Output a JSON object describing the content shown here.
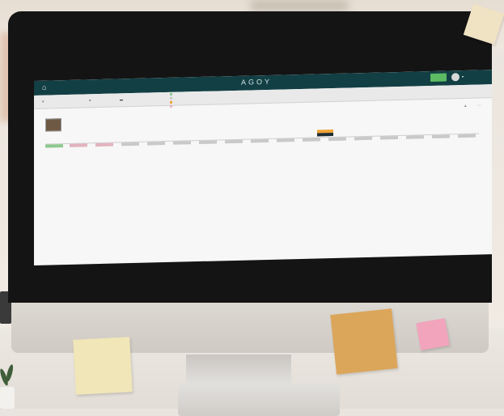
{
  "scene": {
    "background": "#ece6de",
    "note_colors": [
      "#f0e3c4",
      "#f1e6b8",
      "#dca65a",
      "#f2a4bd"
    ]
  },
  "app": {
    "home_icon": "home-icon",
    "brand": "AGOY",
    "accent": "#123f44",
    "action_button_color": "#5dbb63"
  }
}
